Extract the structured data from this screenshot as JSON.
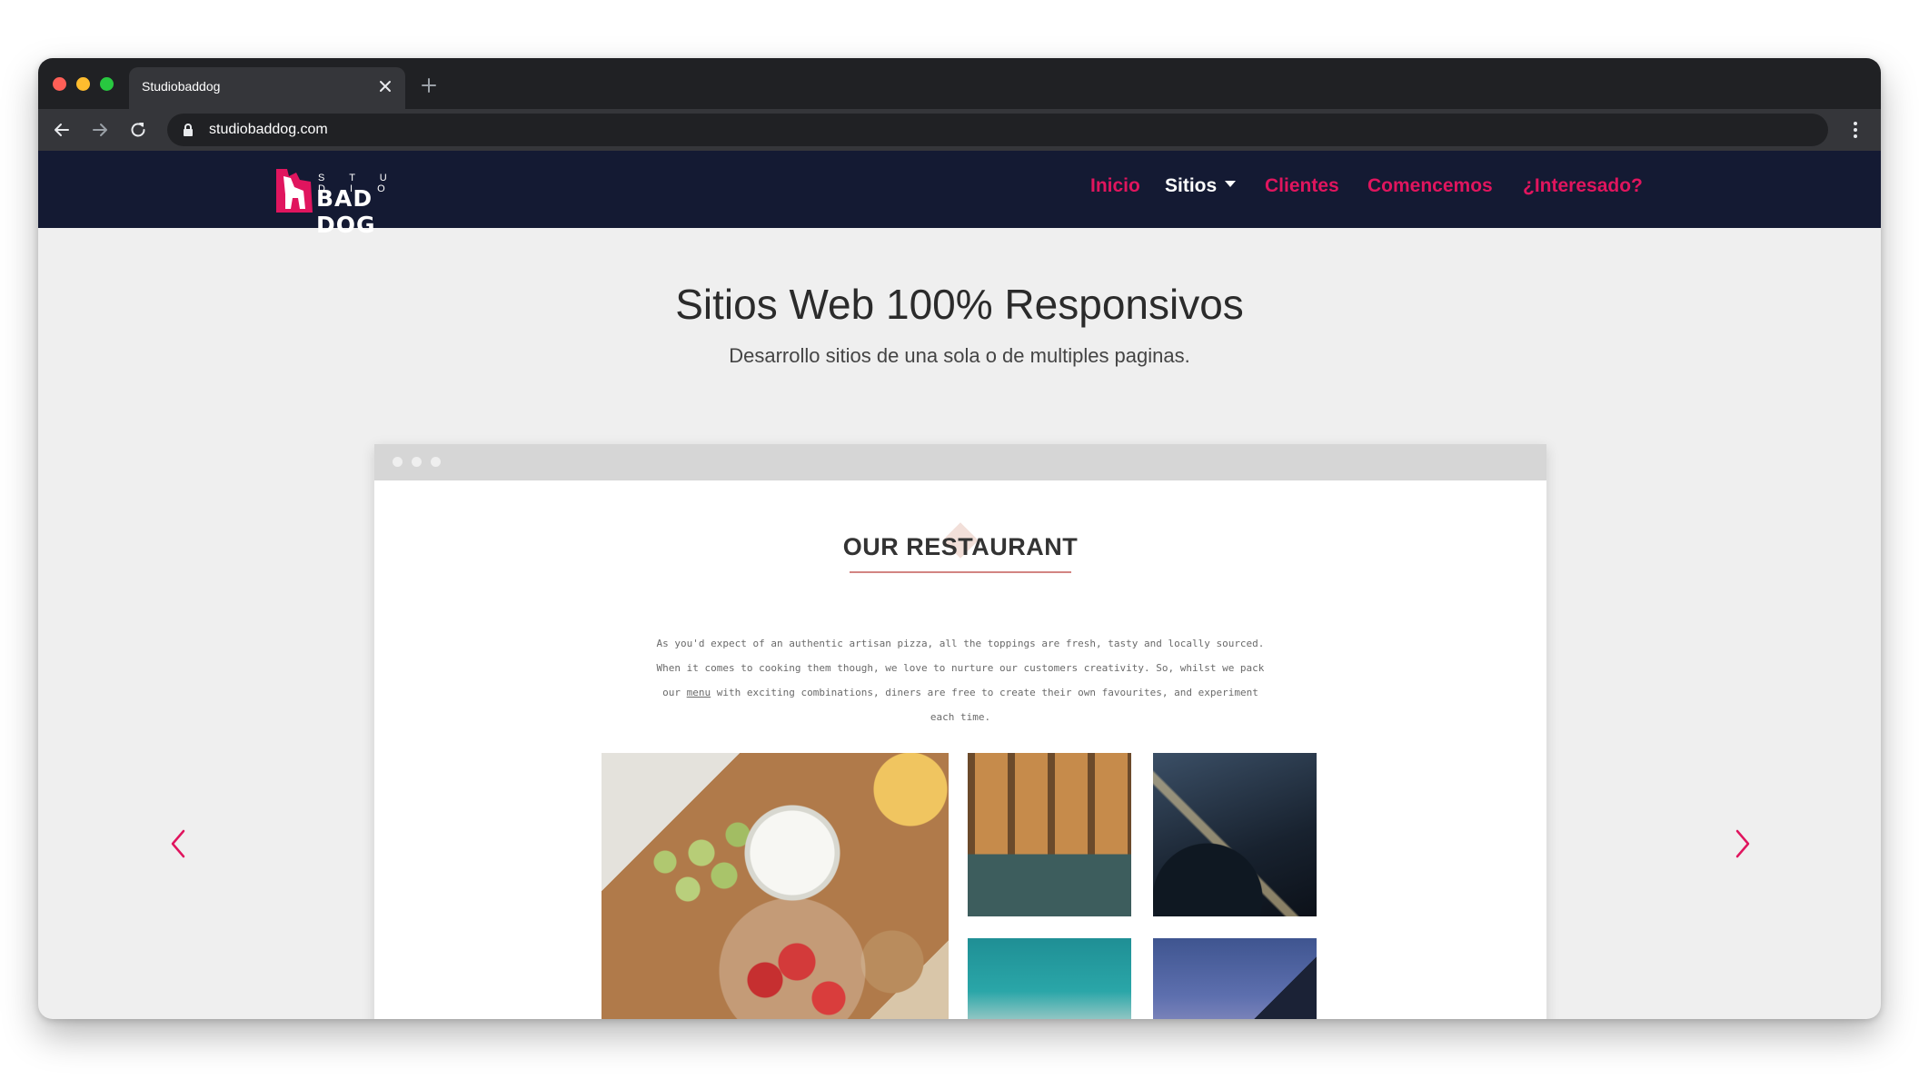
{
  "browser": {
    "tab_title": "Studiobaddog",
    "url": "studiobaddog.com"
  },
  "site": {
    "logo": {
      "small": "S T U D I O",
      "name": "BAD DOG"
    },
    "nav": {
      "inicio": "Inicio",
      "sitios": "Sitios",
      "clientes": "Clientes",
      "comencemos": "Comencemos",
      "interesado": "¿Interesado?"
    },
    "hero": {
      "title": "Sitios Web 100% Responsivos",
      "subtitle": "Desarrollo sitios de una sola o de multiples paginas."
    },
    "mockup": {
      "heading": "OUR RESTAURANT",
      "paragraph_before": "As you'd expect of an authentic artisan pizza, all the toppings are fresh, tasty and locally sourced. When it comes to cooking them though, we love to nurture our customers creativity. So, whilst we pack our ",
      "paragraph_link": "menu",
      "paragraph_after": " with exciting combinations, diners are free to create their own favourites, and experiment each time."
    }
  },
  "colors": {
    "nav_background": "#141a33",
    "accent": "#e0155e",
    "page_background": "#efefef",
    "browser_chrome": "#202124"
  },
  "icons": {
    "tab_close": "close-icon",
    "new_tab": "plus-icon",
    "back": "arrow-left-icon",
    "forward": "arrow-right-icon",
    "reload": "reload-icon",
    "lock": "lock-icon",
    "menu": "kebab-icon",
    "carousel_prev": "chevron-left-icon",
    "carousel_next": "chevron-right-icon"
  }
}
